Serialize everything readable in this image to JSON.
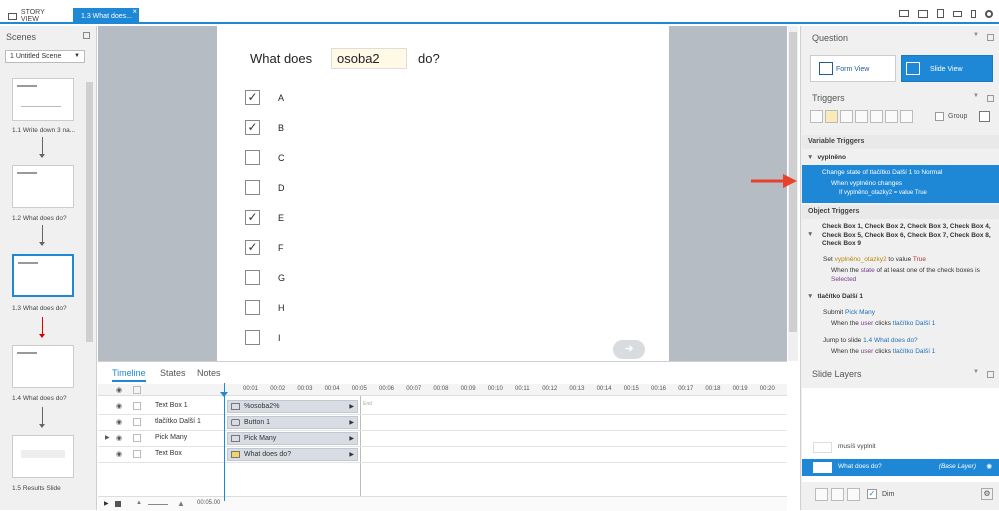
{
  "topbar": {
    "story_view_tab": "STORY VIEW",
    "slide_tab": "1.3 What does...",
    "close_glyph": "×"
  },
  "scenes": {
    "title": "Scenes",
    "selected_scene": "1 Untitled Scene",
    "slides": [
      {
        "label": "1.1 Write down 3 na..."
      },
      {
        "label": "1.2 What does do?"
      },
      {
        "label": "1.3 What does do?"
      },
      {
        "label": "1.4 What does do?"
      },
      {
        "label": "1.5 Results Slide"
      }
    ]
  },
  "slide": {
    "question_before": "What does",
    "question_field": "osoba2",
    "question_after": "do?",
    "options": [
      {
        "label": "A",
        "checked": true
      },
      {
        "label": "B",
        "checked": true
      },
      {
        "label": "C",
        "checked": false
      },
      {
        "label": "D",
        "checked": false
      },
      {
        "label": "E",
        "checked": true
      },
      {
        "label": "F",
        "checked": true
      },
      {
        "label": "G",
        "checked": false
      },
      {
        "label": "H",
        "checked": false
      },
      {
        "label": "I",
        "checked": false
      }
    ],
    "check_glyph": "✓",
    "next_glyph": "➜"
  },
  "timeline": {
    "tabs": [
      "Timeline",
      "States",
      "Notes"
    ],
    "ticks": [
      "00:01",
      "00:02",
      "00:03",
      "00:04",
      "00:05",
      "00:06",
      "00:07",
      "00:08",
      "00:09",
      "00:10",
      "00:11",
      "00:12",
      "00:13",
      "00:14",
      "00:15",
      "00:16",
      "00:17",
      "00:18",
      "00:19",
      "00:20"
    ],
    "end_label": "End",
    "rows": [
      {
        "name": "Text Box 1",
        "bar": "%osoba2%"
      },
      {
        "name": "tlačítko Další 1",
        "bar": "Button 1"
      },
      {
        "name": "Pick Many",
        "bar": "Pick Many"
      },
      {
        "name": "Text Box",
        "bar": "What does do?"
      }
    ],
    "duration": "00:05.00"
  },
  "question_panel": {
    "title": "Question",
    "form_view": "Form View",
    "slide_view": "Slide View"
  },
  "triggers_panel": {
    "title": "Triggers",
    "group_label": "Group",
    "variable_triggers": "Variable Triggers",
    "var_group": "vyplněno",
    "sel_line1": "Change state of tlačítko Další 1 to Normal",
    "sel_line2": "When vyplněno changes",
    "sel_line3": "If vyplněno_otazky2 = value True",
    "object_triggers": "Object Triggers",
    "obj_group": "Check Box 1, Check Box 2, Check Box 3, Check Box 4, Check Box 5, Check Box 6, Check Box 7, Check Box 8, Check Box 9",
    "obj_t1_a": "Set ",
    "obj_t1_var": "vyplněno_otazky2",
    "obj_t1_b": " to value ",
    "obj_t1_val": "True",
    "obj_t1_w1": "When the ",
    "obj_t1_w2": "state",
    "obj_t1_w3": " of at least one of the check boxes is",
    "obj_t1_w4": "Selected",
    "btn_group": "tlačítko Další 1",
    "t2_a": "Submit ",
    "t2_b": "Pick Many",
    "t2_w1": "When the ",
    "t2_w2": "user",
    "t2_w3": " clicks ",
    "t2_w4": "tlačítko Další 1",
    "t3_a": "Jump to slide ",
    "t3_b": "1.4 What does do?",
    "t3_w1": "When the ",
    "t3_w2": "user",
    "t3_w3": " clicks ",
    "t3_w4": "tlačítko Další 1"
  },
  "layers_panel": {
    "title": "Slide Layers",
    "layers": [
      {
        "name": "musíš vyplnit"
      },
      {
        "name": "What does do?",
        "tag": "(Base Layer)"
      }
    ],
    "dim_label": "Dim"
  },
  "colors": {
    "accent": "#1e88d6",
    "annotation_arrow": "#e8412c"
  }
}
